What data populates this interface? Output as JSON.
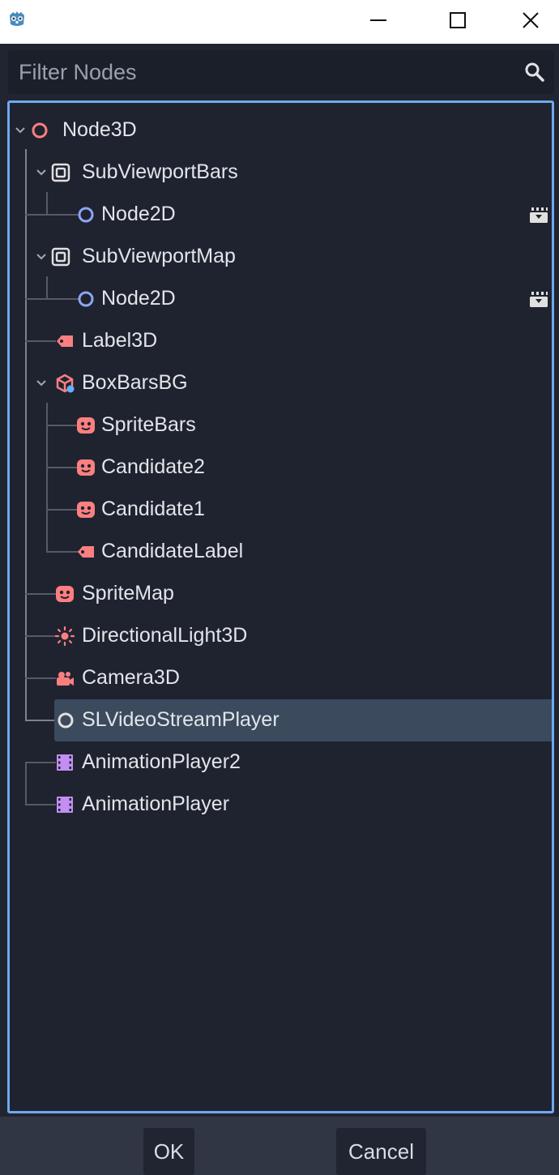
{
  "window": {
    "app_icon": "godot-icon",
    "controls": [
      "minimize-icon",
      "maximize-icon",
      "close-icon"
    ]
  },
  "filter": {
    "placeholder": "Filter Nodes",
    "value": "",
    "icon": "search-icon"
  },
  "tree": {
    "nodes": [
      {
        "label": "Node3D",
        "icon": "node3d-icon",
        "depth": 0,
        "expanded": true
      },
      {
        "label": "SubViewportBars",
        "icon": "subviewport-icon",
        "depth": 1,
        "expanded": true
      },
      {
        "label": "Node2D",
        "icon": "node2d-icon",
        "depth": 2,
        "action_icon": "clapperboard-icon"
      },
      {
        "label": "SubViewportMap",
        "icon": "subviewport-icon",
        "depth": 1,
        "expanded": true
      },
      {
        "label": "Node2D",
        "icon": "node2d-icon",
        "depth": 2,
        "action_icon": "clapperboard-icon"
      },
      {
        "label": "Label3D",
        "icon": "label3d-icon",
        "depth": 1
      },
      {
        "label": "BoxBarsBG",
        "icon": "csgbox-icon",
        "depth": 1,
        "expanded": true
      },
      {
        "label": "SpriteBars",
        "icon": "sprite3d-icon",
        "depth": 2
      },
      {
        "label": "Candidate2",
        "icon": "sprite3d-icon",
        "depth": 2
      },
      {
        "label": "Candidate1",
        "icon": "sprite3d-icon",
        "depth": 2
      },
      {
        "label": "CandidateLabel",
        "icon": "label3d-icon",
        "depth": 2
      },
      {
        "label": "SpriteMap",
        "icon": "sprite3d-icon",
        "depth": 1
      },
      {
        "label": "DirectionalLight3D",
        "icon": "directional-light-icon",
        "depth": 1
      },
      {
        "label": "Camera3D",
        "icon": "camera3d-icon",
        "depth": 1
      },
      {
        "label": "SLVideoStreamPlayer",
        "icon": "node-icon",
        "depth": 1,
        "selected": true
      },
      {
        "label": "AnimationPlayer2",
        "icon": "animation-player-icon",
        "depth": 1
      },
      {
        "label": "AnimationPlayer",
        "icon": "animation-player-icon",
        "depth": 1
      }
    ]
  },
  "footer": {
    "ok_label": "OK",
    "cancel_label": "Cancel"
  },
  "colors": {
    "accent": "#6fa9ee",
    "background": "#202531",
    "selection": "#3b4a5c",
    "node3d": "#fc7f7f",
    "node2d": "#8da5f3",
    "animation": "#c38ef1"
  }
}
